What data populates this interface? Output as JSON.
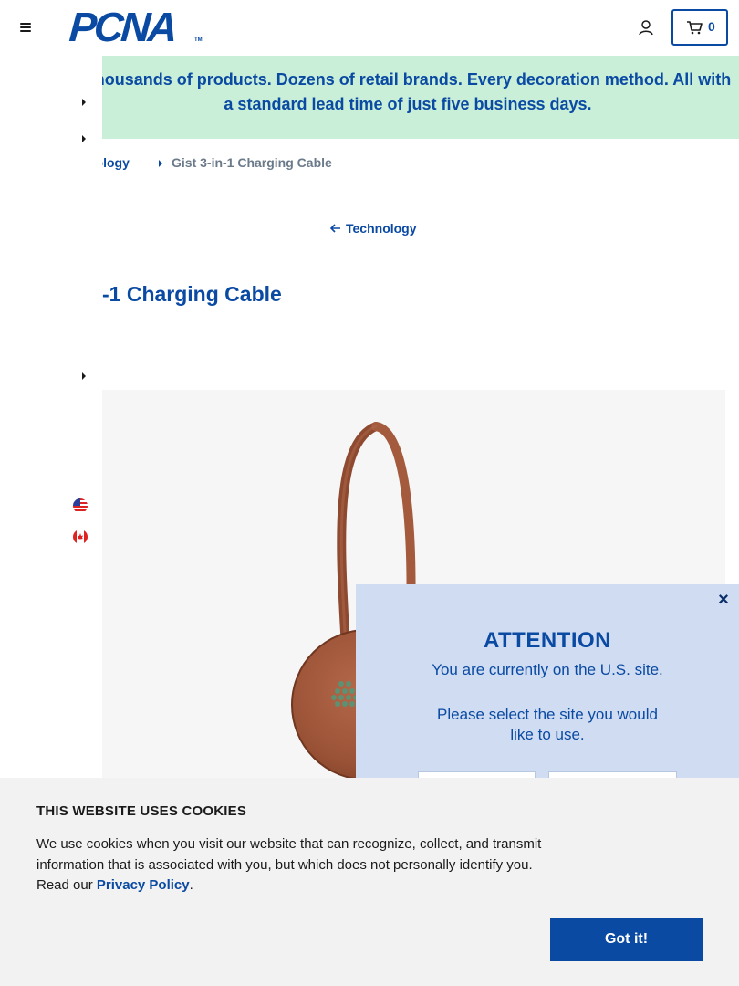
{
  "header": {
    "logo_text": "PCNA",
    "logo_tm": "TM",
    "cart_count": "0"
  },
  "promo": {
    "text": "Thousands of products. Dozens of retail brands. Every decoration method. All with a standard lead time of just five business days."
  },
  "breadcrumb": {
    "category": "nology",
    "current": "Gist 3-in-1 Charging Cable"
  },
  "back_link": {
    "label": "Technology"
  },
  "product": {
    "title": "-1 Charging Cable",
    "image_color": "#a75a3c"
  },
  "attention": {
    "title": "ATTENTION",
    "message": "You are currently on the U.S. site.",
    "prompt": "Please select the site you would like to use.",
    "close_label": "×"
  },
  "cookie": {
    "title": "THIS WEBSITE USES COOKIES",
    "body_before": "We use cookies when you visit our website that can recognize, collect, and transmit information that is associated with you, but which does not personally identify you. Read our ",
    "link": "Privacy Policy",
    "body_after": ".",
    "button": "Got it!"
  },
  "colors": {
    "brand_blue": "#0a4aa3",
    "promo_bg": "#c9efd8",
    "modal_bg": "#cfdcf1",
    "cookie_bg": "#f2f2f2"
  },
  "icons": [
    "menu-icon",
    "account-icon",
    "cart-icon",
    "caret-right-icon",
    "arrow-left-icon",
    "us-flag-icon",
    "canada-flag-icon",
    "close-icon"
  ]
}
